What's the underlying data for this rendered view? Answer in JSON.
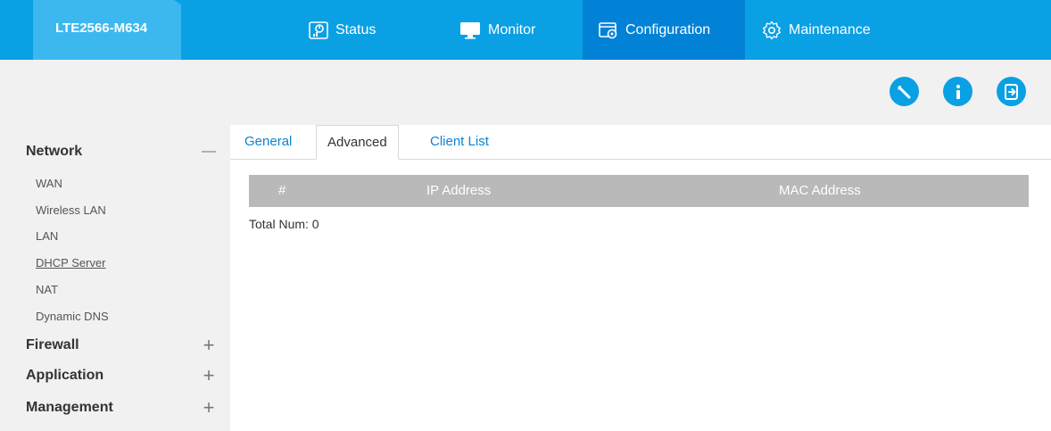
{
  "header": {
    "brand": "LTE2566-M634",
    "nav": [
      {
        "label": "Status",
        "icon": "status-icon"
      },
      {
        "label": "Monitor",
        "icon": "monitor-icon"
      },
      {
        "label": "Configuration",
        "icon": "configuration-icon",
        "active": true
      },
      {
        "label": "Maintenance",
        "icon": "gear-icon"
      }
    ],
    "accent": "#0aa0e4",
    "active_bg": "#0282d6"
  },
  "toolbar": {
    "buttons": [
      "wizard-icon",
      "info-icon",
      "logout-icon"
    ]
  },
  "sidebar": {
    "sections": [
      {
        "label": "Network",
        "toggle": "—",
        "expanded": true,
        "items": [
          "WAN",
          "Wireless LAN",
          "LAN",
          "DHCP Server",
          "NAT",
          "Dynamic DNS"
        ],
        "current": "DHCP Server"
      },
      {
        "label": "Firewall",
        "toggle": "+"
      },
      {
        "label": "Application",
        "toggle": "+"
      },
      {
        "label": "Management",
        "toggle": "+"
      }
    ]
  },
  "tabs": [
    {
      "label": "General"
    },
    {
      "label": "Advanced",
      "active": true
    },
    {
      "label": "Client List"
    }
  ],
  "table": {
    "columns": [
      "#",
      "IP Address",
      "MAC Address"
    ],
    "rows": [],
    "total_label": "Total Num: 0"
  }
}
